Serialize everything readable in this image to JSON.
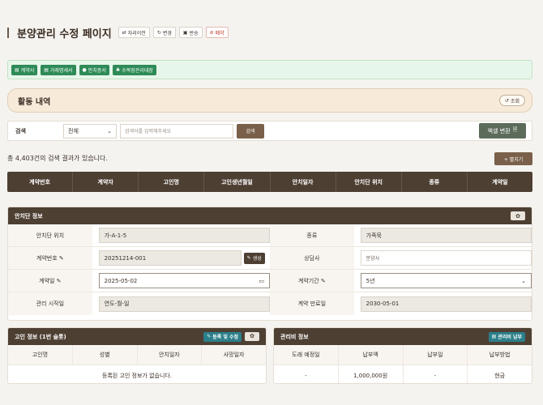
{
  "header": {
    "title": "분양관리 수정 페이지",
    "buttons": [
      {
        "icon": "transfer-icon",
        "glyph": "⇄",
        "label": "자리이전"
      },
      {
        "icon": "refresh-icon",
        "glyph": "↻",
        "label": "변경"
      },
      {
        "icon": "return-icon",
        "glyph": "▣",
        "label": "반송"
      },
      {
        "icon": "ban-icon",
        "glyph": "⊘",
        "label": "폐약"
      }
    ]
  },
  "docs": [
    {
      "icon": "document-icon",
      "glyph": "▤",
      "label": "계약서"
    },
    {
      "icon": "document-icon",
      "glyph": "▤",
      "label": "거래명세서"
    },
    {
      "icon": "circle-icon",
      "glyph": "●",
      "label": "안치증서"
    },
    {
      "icon": "bell-icon",
      "glyph": "♣",
      "label": "수목장관리대장"
    }
  ],
  "section": {
    "title": "활동 내역",
    "lookup_label": "조회"
  },
  "search": {
    "label": "검색",
    "scope": "전체",
    "placeholder": "검색어를 입력해주세요",
    "button": "검색",
    "excel": "엑셀 변환"
  },
  "results": {
    "count_text": "총 4,403건의 검색 결과가 있습니다.",
    "add_button": "+ 펼치기"
  },
  "table": {
    "columns": [
      "계약번호",
      "계약자",
      "고인명",
      "고인생년월일",
      "안치일자",
      "안치단 위치",
      "종류",
      "계약일"
    ]
  },
  "placement": {
    "title": "안치단 정보",
    "rows": [
      {
        "l1": "안치단 위치",
        "v1": "가-A-1-5",
        "t1": "ro",
        "l2": "종류",
        "v2": "가족묵",
        "t2": "ro"
      },
      {
        "l1": "계약번호 ✎",
        "v1": "20251214-001",
        "t1": "ro-gen",
        "l2": "상담사",
        "v2": "분양사",
        "t2": "plain"
      },
      {
        "l1": "계약일 ✎",
        "v1": "2025-05-02",
        "t1": "date",
        "l2": "계약기간 ✎",
        "v2": "5년",
        "t2": "select"
      },
      {
        "l1": "관리 시작일",
        "v1": "연도-월-일",
        "t1": "ro",
        "l2": "계약 만료일",
        "v2": "2030-05-01",
        "t2": "ro"
      }
    ],
    "generate_button": "생성"
  },
  "deceased": {
    "title": "고인 정보 (1번 슬롯)",
    "register_button": "등록 및 수정",
    "columns": [
      "고인명",
      "성별",
      "안치일자",
      "사망일자"
    ],
    "empty_text": "등록된 고인 정보가 없습니다."
  },
  "fee": {
    "title": "관리비 정보",
    "pay_button": "관리비 납부",
    "columns": [
      "도래 예정일",
      "납부액",
      "납부일",
      "납부방법"
    ],
    "row": [
      "-",
      "1,000,000원",
      "-",
      "현금"
    ]
  }
}
